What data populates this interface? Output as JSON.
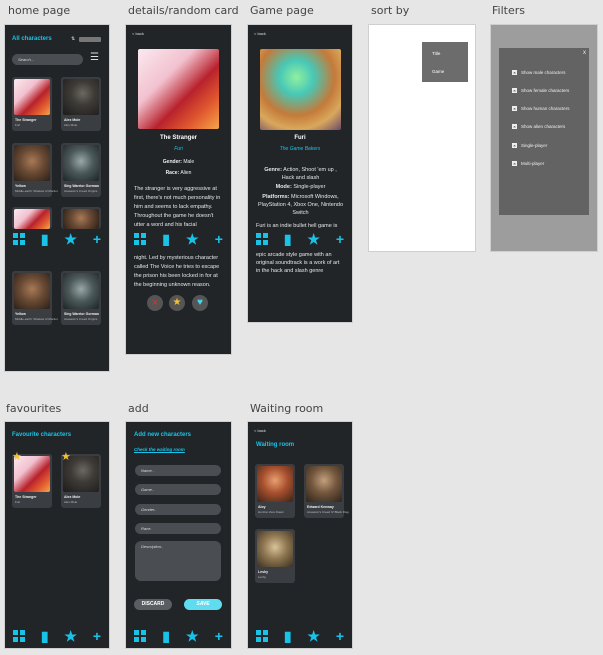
{
  "labels": {
    "home": "home page",
    "details": "details/random card",
    "game": "Game page",
    "sortby": "sort by",
    "filters": "Filters",
    "favourites": "favourites",
    "add": "add",
    "waiting": "Waiting room"
  },
  "home": {
    "header": "All characters",
    "search_placeholder": "Search...",
    "cards": [
      {
        "name": "The Stranger",
        "game": "Furi"
      },
      {
        "name": "Alex Mole",
        "game": "Alex Mole"
      },
      {
        "name": "Yellow",
        "game": "Middle-earth: Shadow of Mordor"
      },
      {
        "name": "Sleg Warrior Gorman",
        "game": "Assassin's Creed Origins"
      },
      {
        "name": "Yellow",
        "game": "Middle-earth: Shadow of Mordor"
      },
      {
        "name": "Sleg Warrior Gorman",
        "game": "Assassin's Creed Origins"
      }
    ]
  },
  "details": {
    "back": "< back",
    "name": "The Stranger",
    "game": "Furi",
    "gender_label": "Gender:",
    "gender": "Male",
    "race_label": "Race:",
    "race": "Alien",
    "desc1": "The stranger is very aggressive at first, there's not much personality in him and seems to lack empathy. Throughout the game he doesn't utter a word and his facial",
    "desc2": "night. Led by mysterious character called The Voice he tries to escape the prison his been locked in for at the beginning unknown reason."
  },
  "game": {
    "back": "< back",
    "title": "Furi",
    "studio": "The Game Bakers",
    "genre_label": "Genre:",
    "genre": "Action, Shoot 'em up , Hack and slash",
    "mode_label": "Mode:",
    "mode": "Single-player",
    "platforms_label": "Platforms:",
    "platforms": "Microsoft Windows, PlayStation 4, Xbox One, Nintendo Switch",
    "desc1": "Furi is an indie bullet hell game is",
    "desc2": "epic arcade style game with an original soundtrack is a work of art in the hack and slash genre"
  },
  "sort": {
    "options": [
      "Title",
      "Game"
    ]
  },
  "filters": {
    "close": "x",
    "options": [
      "Show male characters",
      "Show female characters",
      "Show human characters",
      "Show alien characters",
      "Single-player",
      "Multi-player"
    ]
  },
  "favourites": {
    "header": "Favourite characters",
    "cards": [
      {
        "name": "The Stranger",
        "game": "Furi"
      },
      {
        "name": "Alex Mole",
        "game": "Alex Mole"
      }
    ]
  },
  "add": {
    "header": "Add new characters",
    "link": "Check the waiting room",
    "fields": [
      "Name..",
      "Game..",
      "Gender..",
      "Race..",
      "Description.."
    ],
    "discard": "DISCARD",
    "save": "SAVE"
  },
  "waiting": {
    "back": "< back",
    "header": "Waiting room",
    "cards": [
      {
        "name": "Aloy",
        "game": "Horizon Zero Dawn"
      },
      {
        "name": "Edward Kenway",
        "game": "Assassin's Creed IV Black Flag"
      },
      {
        "name": "Leshy",
        "game": "Leshy"
      }
    ]
  }
}
